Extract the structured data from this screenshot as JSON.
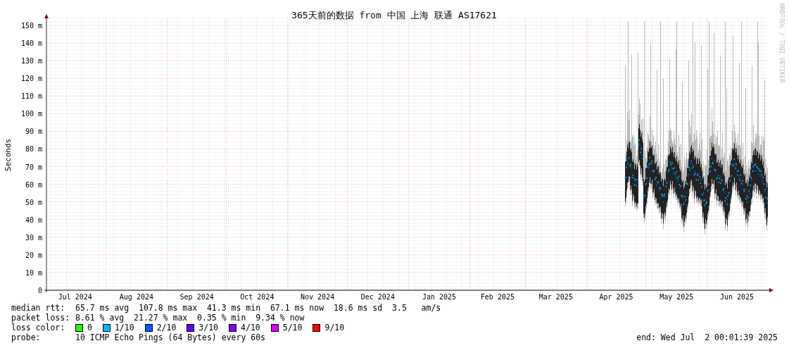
{
  "title": "365天前的数据 from 中国 上海 联通 AS17621",
  "watermark": "RRDTOOL / TOBI OETIKER",
  "y_axis": {
    "label": "Seconds",
    "ticks": [
      "150 m",
      "140 m",
      "130 m",
      "120 m",
      "110 m",
      "100 m",
      "90 m",
      "80 m",
      "70 m",
      "60 m",
      "50 m",
      "40 m",
      "30 m",
      "20 m",
      "10 m",
      "0"
    ]
  },
  "x_axis": {
    "ticks": [
      "Jul 2024",
      "Aug 2024",
      "Sep 2024",
      "Oct 2024",
      "Nov 2024",
      "Dec 2024",
      "Jan 2025",
      "Feb 2025",
      "Mar 2025",
      "Apr 2025",
      "May 2025",
      "Jun 2025"
    ]
  },
  "legend": {
    "median_rtt": {
      "label": "median rtt:",
      "text": "65.7 ms avg  107.8 ms max  41.3 ms min  67.1 ms now  18.6 ms sd  3.5   am/s"
    },
    "packet_loss": {
      "label": "packet loss:",
      "text": "8.61 % avg  21.27 % max  0.35 % min  9.34 % now"
    },
    "loss_color": {
      "label": "loss color:",
      "items": [
        {
          "label": "0",
          "color": "#26ff00"
        },
        {
          "label": "1/10",
          "color": "#00b8ff"
        },
        {
          "label": "2/10",
          "color": "#0059ff"
        },
        {
          "label": "3/10",
          "color": "#5e00ff"
        },
        {
          "label": "4/10",
          "color": "#7e00ff"
        },
        {
          "label": "5/10",
          "color": "#dd00ff"
        },
        {
          "label": "9/10",
          "color": "#ff0000"
        }
      ]
    },
    "probe": {
      "label": "probe:",
      "text": "10 ICMP Echo Pings (64 Bytes) every 60s"
    },
    "end": "end: Wed Jul  2 00:01:39 2025"
  }
}
